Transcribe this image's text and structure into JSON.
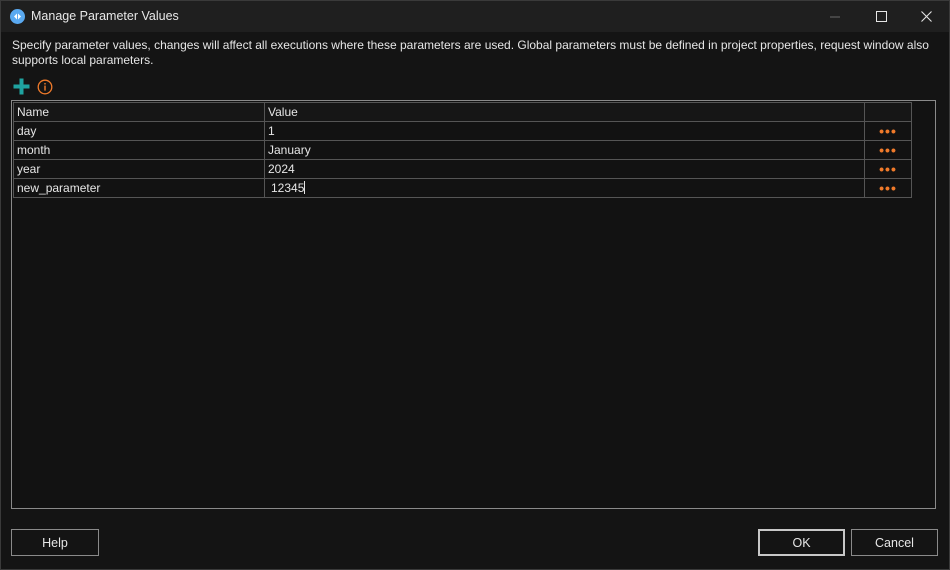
{
  "window": {
    "title": "Manage Parameter Values",
    "controls": [
      "minimize-icon",
      "maximize-icon",
      "close-icon"
    ]
  },
  "description": "Specify parameter values, changes will affect all executions where these parameters are used. Global parameters must be defined in project properties, request window also supports local parameters.",
  "toolbar": {
    "icons": [
      "add-icon",
      "info-icon"
    ],
    "add_color": "#1fa3a0",
    "info_color": "#f07a2a"
  },
  "grid": {
    "columns": [
      "Name",
      "Value",
      ""
    ],
    "rows": [
      {
        "name": "day",
        "value": "1",
        "action": "•••"
      },
      {
        "name": "month",
        "value": "January",
        "action": "•••"
      },
      {
        "name": "year",
        "value": "2024",
        "action": "•••"
      },
      {
        "name": "new_parameter",
        "value": "12345",
        "action": "•••"
      }
    ],
    "editing_row": 3
  },
  "buttons": {
    "help": "Help",
    "ok": "OK",
    "cancel": "Cancel"
  }
}
